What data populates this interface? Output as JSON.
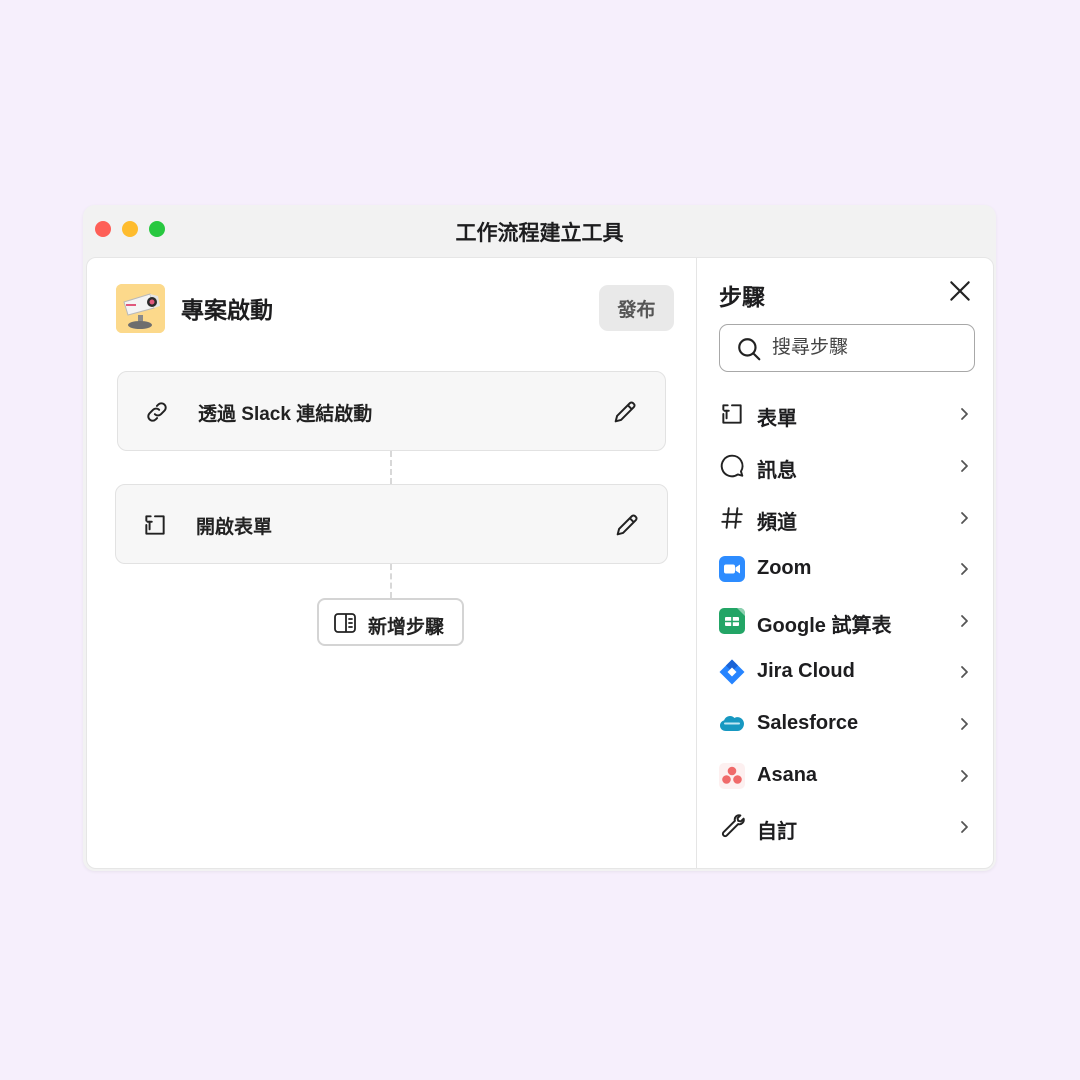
{
  "window": {
    "title": "工作流程建立工具"
  },
  "workflow": {
    "title": "專案啟動",
    "publish_label": "發布",
    "steps": [
      {
        "label": "透過 Slack 連結啟動",
        "icon": "link-icon"
      },
      {
        "label": "開啟表單",
        "icon": "form-icon"
      }
    ],
    "add_step_label": "新增步驟"
  },
  "panel": {
    "title": "步驟",
    "search_placeholder": "搜尋步驟",
    "items": [
      {
        "label": "表單",
        "icon": "form-icon"
      },
      {
        "label": "訊息",
        "icon": "message-icon"
      },
      {
        "label": "頻道",
        "icon": "hash-icon"
      },
      {
        "label": "Zoom",
        "icon": "zoom-icon"
      },
      {
        "label": "Google 試算表",
        "icon": "google-sheets-icon"
      },
      {
        "label": "Jira Cloud",
        "icon": "jira-icon"
      },
      {
        "label": "Salesforce",
        "icon": "salesforce-icon"
      },
      {
        "label": "Asana",
        "icon": "asana-icon"
      },
      {
        "label": "自訂",
        "icon": "wrench-icon"
      }
    ]
  },
  "colors": {
    "background": "#f6effc",
    "zoom": "#2d8cff",
    "google_sheets": "#23a566",
    "jira": "#2684ff",
    "salesforce": "#1798c1",
    "asana": "#f06a6a",
    "workflow_icon_bg": "#fcd98b"
  }
}
